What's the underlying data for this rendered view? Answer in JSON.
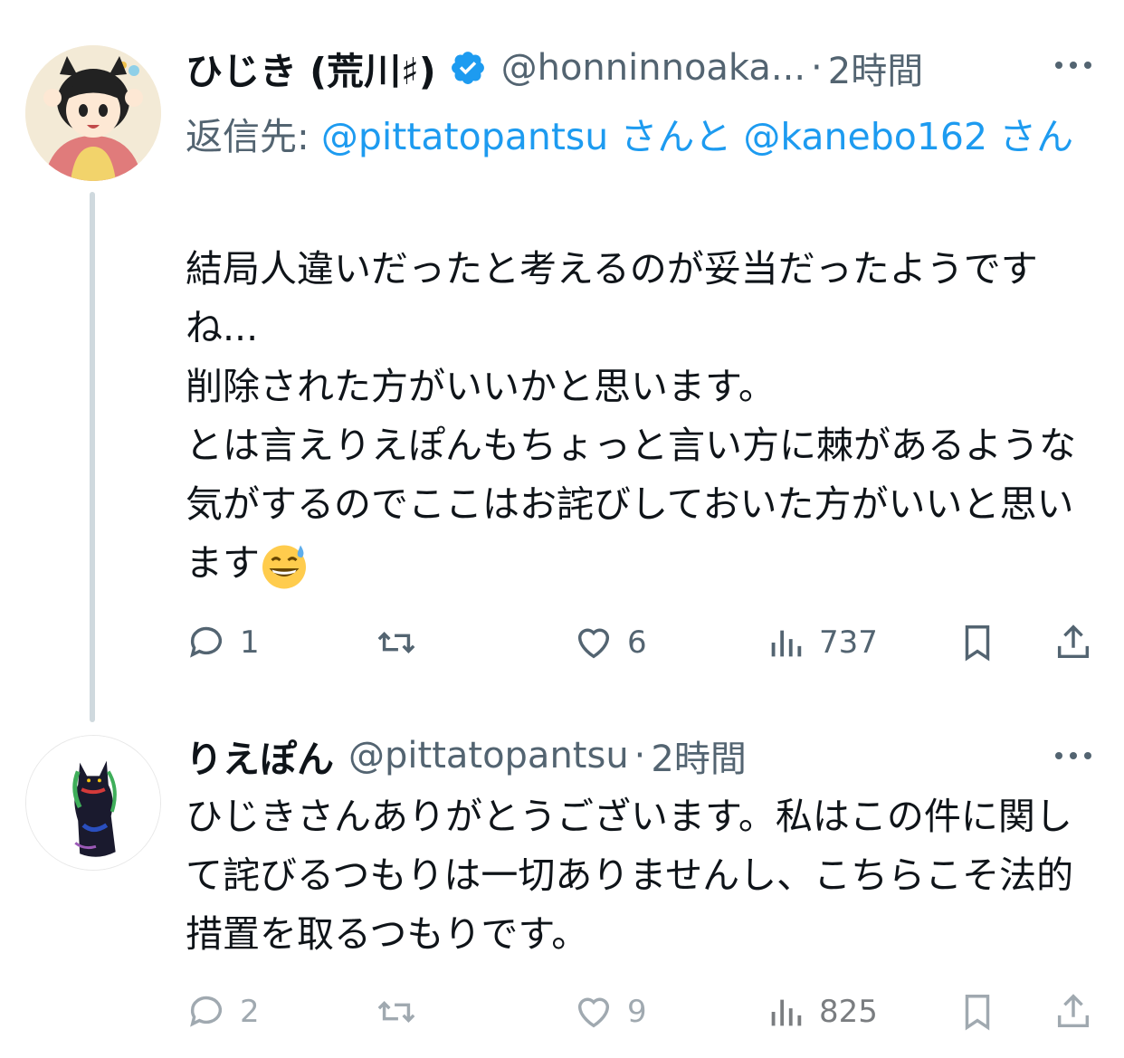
{
  "tweets": [
    {
      "display_name": "ひじき (荒川♯)",
      "handle": "@honninnoaka...",
      "separator": "·",
      "time": "2時間",
      "reply_to": {
        "prefix": "返信先: ",
        "user1": "@pittatopantsu",
        "joiner": " さんと ",
        "user2": "@kanebo162",
        "suffix": " さん"
      },
      "text": "結局人違いだったと考えるのが妥当だったようですね...\n削除された方がいいかと思います。\nとは言えりえぽんもちょっと言い方に棘があるような気がするのでここはお詫びしておいた方がいいと思います",
      "emoji": "grinning-face-with-sweat",
      "actions": {
        "replies": "1",
        "retweets": "",
        "likes": "6",
        "views": "737"
      }
    },
    {
      "display_name": "りえぽん",
      "handle": "@pittatopantsu",
      "separator": "·",
      "time": "2時間",
      "text": "ひじきさんありがとうございます。私はこの件に関して詫びるつもりは一切ありませんし、こちらこそ法的措置を取るつもりです。",
      "actions": {
        "replies": "2",
        "retweets": "",
        "likes": "9",
        "views": "825"
      }
    }
  ],
  "colors": {
    "accent": "#1d9bf0",
    "secondary_text": "#536471",
    "thread_line": "#cfd9de"
  }
}
